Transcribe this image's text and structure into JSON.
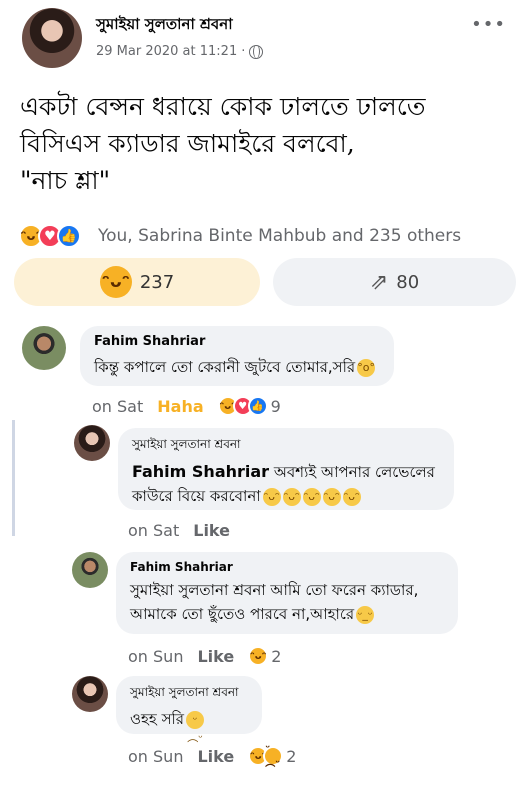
{
  "post": {
    "author": "সুমাইয়া সুলতানা শ্রবনা",
    "timestamp": "29 Mar 2020 at 11:21",
    "visibility_separator": "·",
    "more_label": "•••",
    "text_line1": "একটা বেন্সন ধরায়ে কোক ঢালতে ঢালতে",
    "text_line2": "বিসিএস ক্যাডার জামাইরে বলবো,",
    "text_line3": "\"নাচ শ্লা\"",
    "reactions_summary": "You, Sabrina Binte Mahbub and 235 others",
    "haha_count": "237",
    "share_count": "80"
  },
  "comments": [
    {
      "author": "Fahim Shahriar",
      "text": "কিন্তু কপালে তো কেরানী জুটবে তোমার,সরি",
      "time": "on Sat",
      "action": "Haha",
      "reaction_count": "9"
    },
    {
      "author": "সুমাইয়া সুলতানা শ্রবনা",
      "mention": "Fahim Shahriar",
      "text_line1": " অবশ্যই আপনার লেভেলের",
      "text_line2": "কাউরে বিয়ে করবোনা",
      "time": "on Sat",
      "action": "Like"
    },
    {
      "author": "Fahim Shahriar",
      "text_line1": "সুমাইয়া সুলতানা শ্রবনা আমি তো ফরেন ক্যাডার,",
      "text_line2": "আমাকে তো ছুঁতেও পারবে না,আহারে",
      "time": "on Sun",
      "action": "Like",
      "reaction_count": "2"
    },
    {
      "author": "সুমাইয়া সুলতানা শ্রবনা",
      "text": "ওহহ সরি",
      "time": "on Sun",
      "action": "Like",
      "reaction_count": "2"
    }
  ],
  "icons": {
    "haha": "😆",
    "love": "♥",
    "like": "👍",
    "share": "↗",
    "sad": "😢"
  },
  "colors": {
    "like_blue": "#1877f2",
    "love_red": "#f33e58",
    "haha_yellow": "#f7b125",
    "bubble_bg": "#f0f2f5"
  }
}
